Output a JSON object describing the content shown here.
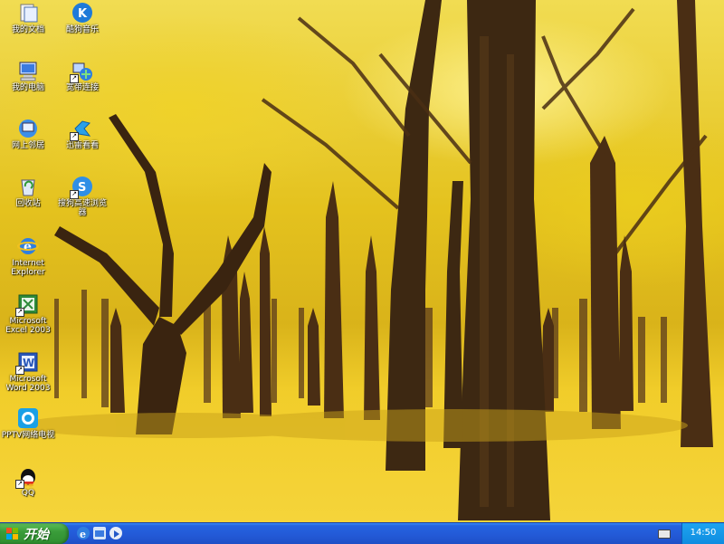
{
  "desktop": {
    "icons": [
      {
        "label": "我的文档",
        "icon": "my-documents-icon"
      },
      {
        "label": "酷狗音乐",
        "icon": "kugou-music-icon"
      },
      {
        "label": "我的电脑",
        "icon": "my-computer-icon"
      },
      {
        "label": "宽带连接",
        "icon": "broadband-connection-icon"
      },
      {
        "label": "网上邻居",
        "icon": "network-places-icon"
      },
      {
        "label": "迅雷看看",
        "icon": "xunlei-icon"
      },
      {
        "label": "回收站",
        "icon": "recycle-bin-icon"
      },
      {
        "label": "搜狗高速浏览器",
        "icon": "sogou-browser-icon"
      },
      {
        "label": "Internet Explorer",
        "icon": "internet-explorer-icon"
      },
      {
        "label": "Microsoft Excel 2003",
        "icon": "excel-icon"
      },
      {
        "label": "Microsoft Word 2003",
        "icon": "word-icon"
      },
      {
        "label": "PPTV网络电视",
        "icon": "pptv-icon"
      },
      {
        "label": "QQ",
        "icon": "qq-icon"
      }
    ]
  },
  "taskbar": {
    "start_label": "开始",
    "quick_launch": [
      "internet-explorer-icon",
      "show-desktop-icon",
      "media-player-icon"
    ],
    "tray_icons": [
      "keyboard-icon"
    ],
    "clock": "14:50"
  },
  "colors": {
    "taskbar": "#2359d6",
    "start_button": "#3a9c3a",
    "tray": "#0f8ce0",
    "wallpaper_yellow": "#e4c21e"
  }
}
